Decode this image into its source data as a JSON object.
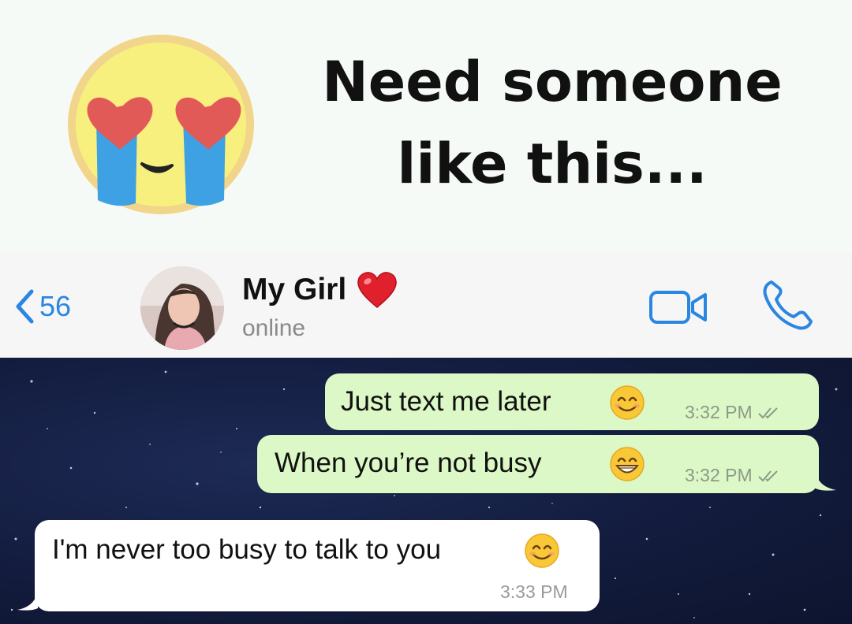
{
  "banner": {
    "line1": "Need someone",
    "line2": "like this...",
    "emoji_icon": "heart-eyes-crying-emoji"
  },
  "header": {
    "back_count": "56",
    "contact_name": "My Girl",
    "contact_status": "online",
    "accent_color": "#2a86e0"
  },
  "messages": [
    {
      "direction": "outgoing",
      "text": "Just text me later",
      "emoji": "smiling-face-emoji",
      "time": "3:32 PM",
      "status": "read"
    },
    {
      "direction": "outgoing",
      "text": "When you’re not busy",
      "emoji": "grinning-face-emoji",
      "time": "3:32 PM",
      "status": "read"
    },
    {
      "direction": "incoming",
      "text": "I'm never too busy to talk to you",
      "emoji": "smiling-face-emoji",
      "time": "3:33 PM"
    }
  ],
  "colors": {
    "outgoing_bubble": "#dcf8c6",
    "incoming_bubble": "#ffffff",
    "chat_background": "#131c3e"
  }
}
